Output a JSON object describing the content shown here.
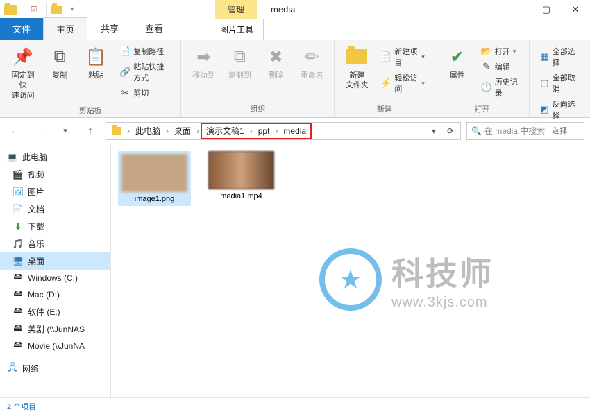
{
  "window": {
    "title": "media"
  },
  "tools_tab": {
    "super": "管理",
    "sub": "图片工具"
  },
  "tabs": {
    "file": "文件",
    "home": "主页",
    "share": "共享",
    "view": "查看"
  },
  "ribbon": {
    "pin": "固定到快\n速访问",
    "copy": "复制",
    "paste": "粘贴",
    "copy_path": "复制路径",
    "paste_shortcut": "粘贴快捷方式",
    "cut": "剪切",
    "clipboard": "剪贴板",
    "move_to": "移动到",
    "copy_to": "复制到",
    "delete": "删除",
    "rename": "重命名",
    "organize": "组织",
    "new_folder": "新建\n文件夹",
    "new_item": "新建项目",
    "easy_access": "轻松访问",
    "new": "新建",
    "properties": "属性",
    "open": "打开",
    "edit": "编辑",
    "history": "历史记录",
    "open_group": "打开",
    "select_all": "全部选择",
    "select_none": "全部取消",
    "select_invert": "反向选择",
    "select": "选择"
  },
  "breadcrumb": {
    "this_pc": "此电脑",
    "desktop": "桌面",
    "p1": "演示文稿1",
    "p2": "ppt",
    "p3": "media"
  },
  "search": {
    "placeholder": "在 media 中搜索"
  },
  "sidebar": {
    "this_pc": "此电脑",
    "video": "视频",
    "pictures": "图片",
    "documents": "文档",
    "downloads": "下载",
    "music": "音乐",
    "desktop": "桌面",
    "drive_c": "Windows (C:)",
    "drive_d": "Mac (D:)",
    "drive_e": "软件 (E:)",
    "drive_tv": "美剧 (\\\\JunNAS",
    "drive_movie": "Movie (\\\\JunNA",
    "network": "网络"
  },
  "files": {
    "f1": "image1.png",
    "f2": "media1.mp4"
  },
  "status": {
    "items": "2 个项目"
  },
  "watermark": {
    "title": "科技师",
    "sub": "www.3kjs.com"
  }
}
